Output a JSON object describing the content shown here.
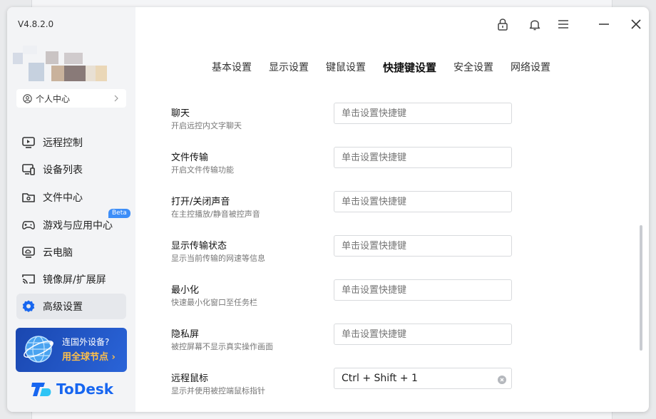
{
  "app": {
    "version": "V4.8.2.0",
    "profile_label": "个人中心",
    "brand": "ToDesk"
  },
  "sidebar": {
    "items": [
      {
        "label": "远程控制",
        "icon": "remote-control-icon"
      },
      {
        "label": "设备列表",
        "icon": "device-list-icon"
      },
      {
        "label": "文件中心",
        "icon": "file-center-icon"
      },
      {
        "label": "游戏与应用中心",
        "icon": "gamepad-icon",
        "badge": "Beta"
      },
      {
        "label": "云电脑",
        "icon": "cloud-pc-icon"
      },
      {
        "label": "镜像屏/扩展屏",
        "icon": "screen-mirror-icon"
      },
      {
        "label": "高级设置",
        "icon": "gear-icon",
        "active": true
      }
    ],
    "promo": {
      "line1": "连国外设备?",
      "line2": "用全球节点 ›"
    }
  },
  "tabs": [
    {
      "label": "基本设置"
    },
    {
      "label": "显示设置"
    },
    {
      "label": "键鼠设置"
    },
    {
      "label": "快捷键设置",
      "active": true
    },
    {
      "label": "安全设置"
    },
    {
      "label": "网络设置"
    }
  ],
  "shortcuts": [
    {
      "title": "聊天",
      "desc": "开启远控内文字聊天",
      "value": "",
      "placeholder": "单击设置快捷键"
    },
    {
      "title": "文件传输",
      "desc": "开启文件传输功能",
      "value": "",
      "placeholder": "单击设置快捷键"
    },
    {
      "title": "打开/关闭声音",
      "desc": "在主控播放/静音被控声音",
      "value": "",
      "placeholder": "单击设置快捷键"
    },
    {
      "title": "显示传输状态",
      "desc": "显示当前传输的网速等信息",
      "value": "",
      "placeholder": "单击设置快捷键"
    },
    {
      "title": "最小化",
      "desc": "快速最小化窗口至任务栏",
      "value": "",
      "placeholder": "单击设置快捷键"
    },
    {
      "title": "隐私屏",
      "desc": "被控屏幕不显示真实操作画面",
      "value": "",
      "placeholder": "单击设置快捷键"
    },
    {
      "title": "远程鼠标",
      "desc": "显示并使用被控端鼠标指针",
      "value": "Ctrl + Shift + 1",
      "placeholder": "单击设置快捷键"
    }
  ],
  "colors": {
    "brand": "#1766f0",
    "promo_accent": "#ffc04a",
    "beta_badge": "#3d8ef8"
  }
}
